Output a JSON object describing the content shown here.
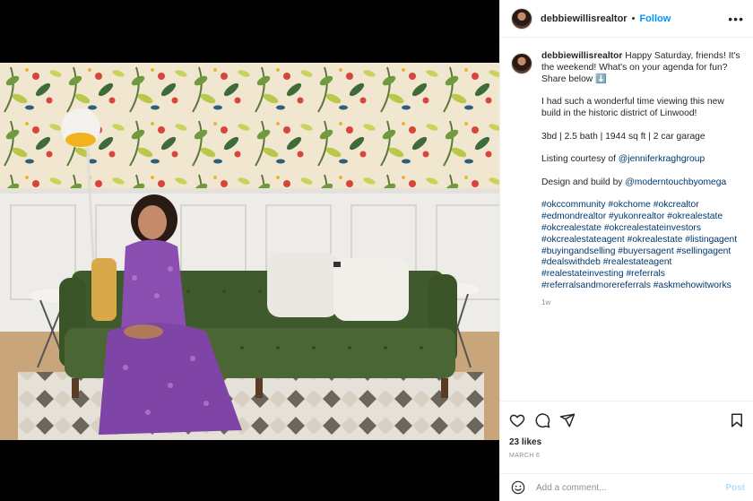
{
  "post": {
    "username": "debbiewillisrealtor",
    "follow_label": "Follow",
    "more_label": "•••",
    "caption": {
      "username": "debbiewillisrealtor",
      "line1": "Happy Saturday, friends! It's the weekend! What's on your agenda for fun? Share below ⬇️",
      "line2": "I had such a wonderful time viewing this new build in the historic district of Linwood!",
      "line3": "3bd | 2.5 bath | 1944 sq ft | 2 car garage",
      "line4_prefix": "Listing courtesy of ",
      "line4_mention": "@jenniferkraghgroup",
      "line5_prefix": "Design and build by ",
      "line5_mention": "@moderntouchbyomega",
      "hashtags": "#okccommunity #okchome #okcrealtor #edmondrealtor #yukonrealtor #okrealestate #okcrealestate #okcrealestateinvestors #okcrealestateagent #okrealestate #listingagent #buyingandselling #buyersagent #sellingagent #dealswithdeb #realestateagent #realestateinvesting #referrals #referralsandmorereferrals #askmehowitworks"
    },
    "time_ago": "1w",
    "likes": "23 likes",
    "date": "MARCH 6",
    "comment_placeholder": "Add a comment...",
    "post_label": "Post",
    "icons": {
      "like": "heart-icon",
      "comment": "comment-icon",
      "share": "share-icon",
      "save": "bookmark-icon",
      "emoji": "emoji-icon"
    },
    "colors": {
      "link": "#00376b",
      "follow": "#0095f6",
      "post_disabled": "#b2dffc"
    }
  }
}
